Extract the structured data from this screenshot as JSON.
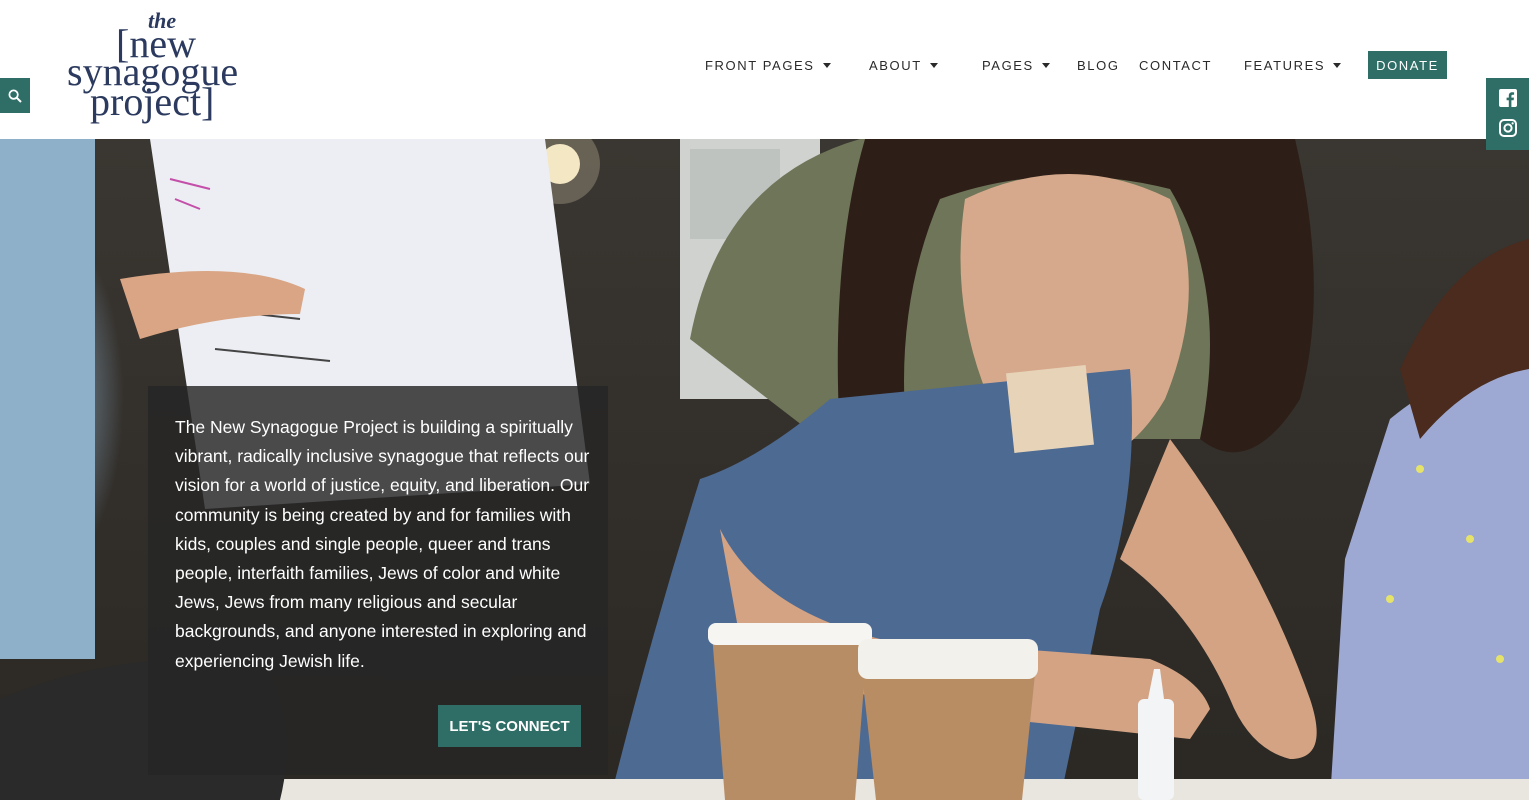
{
  "brand": {
    "logo_line_the": "the",
    "logo_line_1": "[new",
    "logo_line_2": "synagogue",
    "logo_line_3": "project]"
  },
  "nav": {
    "front_pages": "FRONT PAGES",
    "about": "ABOUT",
    "pages": "PAGES",
    "blog": "BLOG",
    "contact": "CONTACT",
    "features": "FEATURES",
    "donate": "DONATE"
  },
  "icons": {
    "search": "search-icon",
    "facebook": "facebook-icon",
    "instagram": "instagram-icon",
    "caret": "chevron-down-icon"
  },
  "hero": {
    "intro": "The New Synagogue Project is building a spiritually vibrant, radically inclusive synagogue that reflects our vision for a world of justice, equity, and liberation. Our community is being created by and for families with kids, couples and single people, queer and trans people, interfaith families, Jews of color and white Jews, Jews from many religious and secular backgrounds, and anyone interested in exploring and experiencing Jewish life.",
    "cta": "LET'S CONNECT"
  },
  "colors": {
    "accent": "#2e6e66",
    "logo": "#2b3a5e",
    "nav_text": "#2a2a2a"
  }
}
